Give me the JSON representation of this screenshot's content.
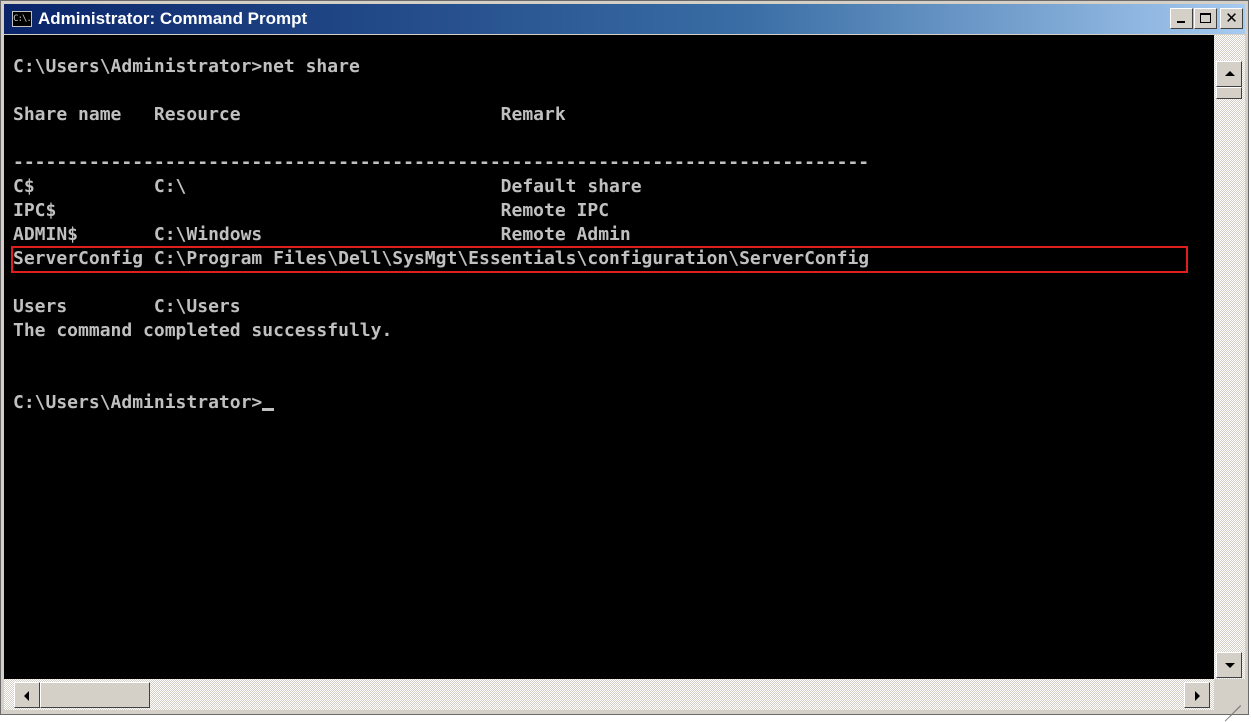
{
  "window": {
    "title": "Administrator: Command Prompt",
    "app_icon_text": "C:\\."
  },
  "console": {
    "lines": [
      "C:\\Users\\Administrator>net share",
      "",
      "Share name   Resource                        Remark",
      "",
      "-------------------------------------------------------------------------------",
      "C$           C:\\                             Default share",
      "IPC$                                         Remote IPC",
      "ADMIN$       C:\\Windows                      Remote Admin",
      "ServerConfig C:\\Program Files\\Dell\\SysMgt\\Essentials\\configuration\\ServerConfig",
      "",
      "Users        C:\\Users",
      "The command completed successfully.",
      "",
      "",
      "C:\\Users\\Administrator>"
    ]
  },
  "colors": {
    "console_bg": "#000000",
    "console_text": "#c0c0c0",
    "highlight_border": "#e01e1e",
    "titlebar": "#0a246a"
  }
}
